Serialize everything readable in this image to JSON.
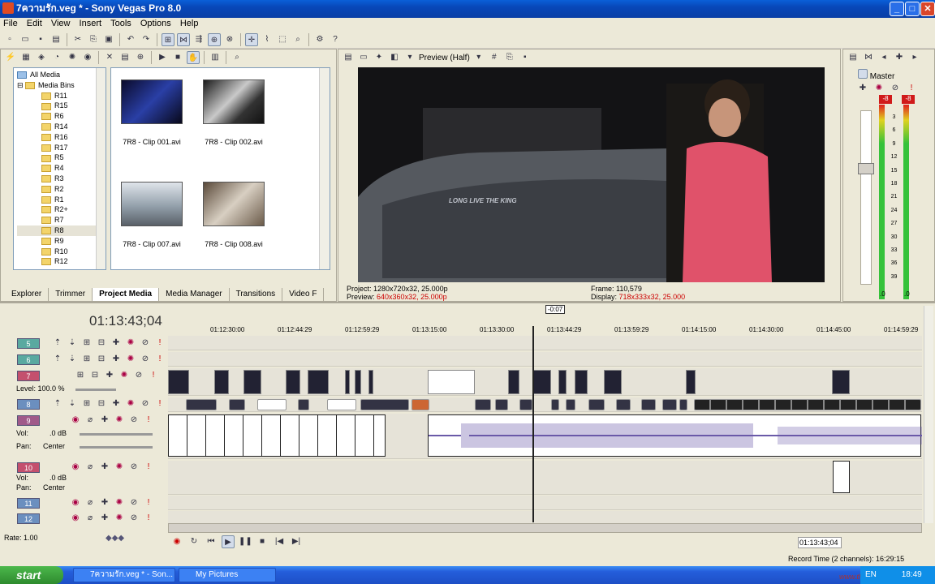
{
  "window": {
    "title": "7ความรัก.veg * - Sony Vegas Pro 8.0",
    "min": "_",
    "max": "□",
    "close": "✕"
  },
  "menu": [
    "File",
    "Edit",
    "View",
    "Insert",
    "Tools",
    "Options",
    "Help"
  ],
  "explorer": {
    "tree": [
      "All Media",
      "Media Bins",
      "R11",
      "R15",
      "R6",
      "R14",
      "R16",
      "R17",
      "R5",
      "R4",
      "R3",
      "R2",
      "R1",
      "R2+",
      "R7",
      "R8",
      "R9",
      "R10",
      "R12"
    ],
    "thumbnails": [
      {
        "label": "7R8 - Clip 001.avi"
      },
      {
        "label": "7R8 - Clip 002.avi"
      },
      {
        "label": "7R8 - Clip 007.avi"
      },
      {
        "label": "7R8 - Clip 008.avi"
      }
    ],
    "tabs": [
      "Explorer",
      "Trimmer",
      "Project Media",
      "Media Manager",
      "Transitions",
      "Video F"
    ]
  },
  "preview": {
    "mode": "Preview (Half)",
    "project_label": "Project:",
    "project": "1280x720x32, 25.000p",
    "preview_label": "Preview:",
    "preview": "640x360x32, 25.000p",
    "frame_label": "Frame:",
    "frame": "110,579",
    "display_label": "Display:",
    "display": "718x333x32, 25.000",
    "overlay_text": "LONG LIVE THE KING"
  },
  "mixer": {
    "label": "Master",
    "peak_l": "-8",
    "peak_r": "-8",
    "scale": [
      "3",
      "6",
      "9",
      "12",
      "15",
      "18",
      "21",
      "24",
      "27",
      "30",
      "33",
      "36",
      "39"
    ],
    "bottom_l": ".0",
    "bottom_r": ".0"
  },
  "timeline": {
    "timecode": "01:13:43;04",
    "cursor_label": "-0:07",
    "ruler": [
      "01:12:30:00",
      "01:12:44:29",
      "01:12:59:29",
      "01:13:15:00",
      "01:13:30:00",
      "01:13:44:29",
      "01:13:59:29",
      "01:14:15:00",
      "01:14:30:00",
      "01:14:45:00",
      "01:14:59:29"
    ],
    "tracks": [
      {
        "num": "5",
        "color": "#5aa9a0"
      },
      {
        "num": "6",
        "color": "#5aa9a0"
      },
      {
        "num": "7",
        "color": "#c4506e"
      },
      {
        "num": "8",
        "color": "#6b8fbf"
      },
      {
        "num": "9",
        "color": "#a05a8a"
      },
      {
        "num": "10",
        "color": "#c4506e"
      },
      {
        "num": "11",
        "color": "#6b8fbf"
      },
      {
        "num": "12",
        "color": "#6b8fbf"
      }
    ],
    "level_label": "Level: 100.0 %",
    "vol_label": "Vol:",
    "vol_value": ".0 dB",
    "pan_label": "Pan:",
    "pan_value": "Center",
    "rate_label": "Rate: 1.00"
  },
  "transport": {
    "timecode": "01:13:43;04"
  },
  "status": {
    "record_time": "Record Time (2 channels): 16:29:15"
  },
  "taskbar": {
    "start": "start",
    "items": [
      "7ความรัก.veg * - Son...",
      "My Pictures"
    ],
    "lang": "EN",
    "clock": "18:49",
    "watermark": "www.thaitv.com"
  },
  "colors": {
    "accent": "#245edb",
    "audio_wave": "#6a5aa8",
    "meter_green": "#35c23a"
  }
}
